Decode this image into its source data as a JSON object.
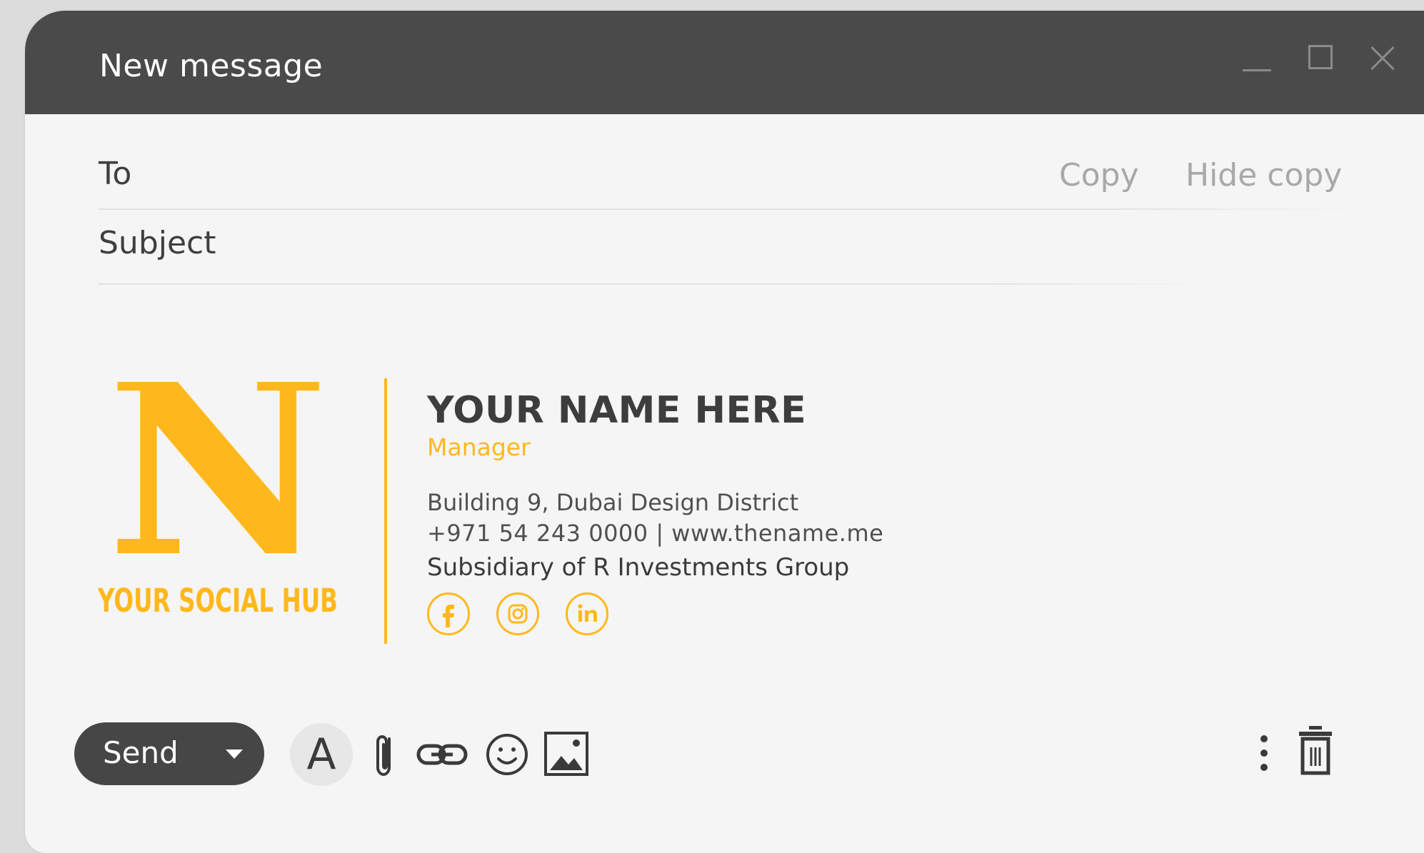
{
  "window": {
    "title": "New message",
    "controls": [
      "minimize-icon",
      "maximize-icon",
      "close-icon"
    ]
  },
  "fields": {
    "to_label": "To",
    "to_value": "",
    "subject_label": "Subject",
    "subject_value": "",
    "copy_label": "Copy",
    "hide_copy_label": "Hide copy"
  },
  "signature": {
    "logo_letter": "N",
    "logo_tagline": "YOUR SOCIAL HUB",
    "name": "YOUR NAME HERE",
    "role": "Manager",
    "address": "Building 9, Dubai Design District",
    "phone_web": "+971 54 243 0000 | www.thename.me",
    "company": "Subsidiary of R Investments Group",
    "social": [
      "facebook-icon",
      "instagram-icon",
      "linkedin-icon"
    ]
  },
  "toolbar": {
    "send_label": "Send",
    "format_letter": "A",
    "icons": [
      "text-format-icon",
      "paperclip-icon",
      "link-icon",
      "emoji-icon",
      "image-icon",
      "more-options-icon",
      "trash-icon"
    ]
  },
  "colors": {
    "accent": "#ffb81c",
    "titlebar": "#4a4a4a",
    "body": "#f5f5f5",
    "send_button": "#464646"
  }
}
